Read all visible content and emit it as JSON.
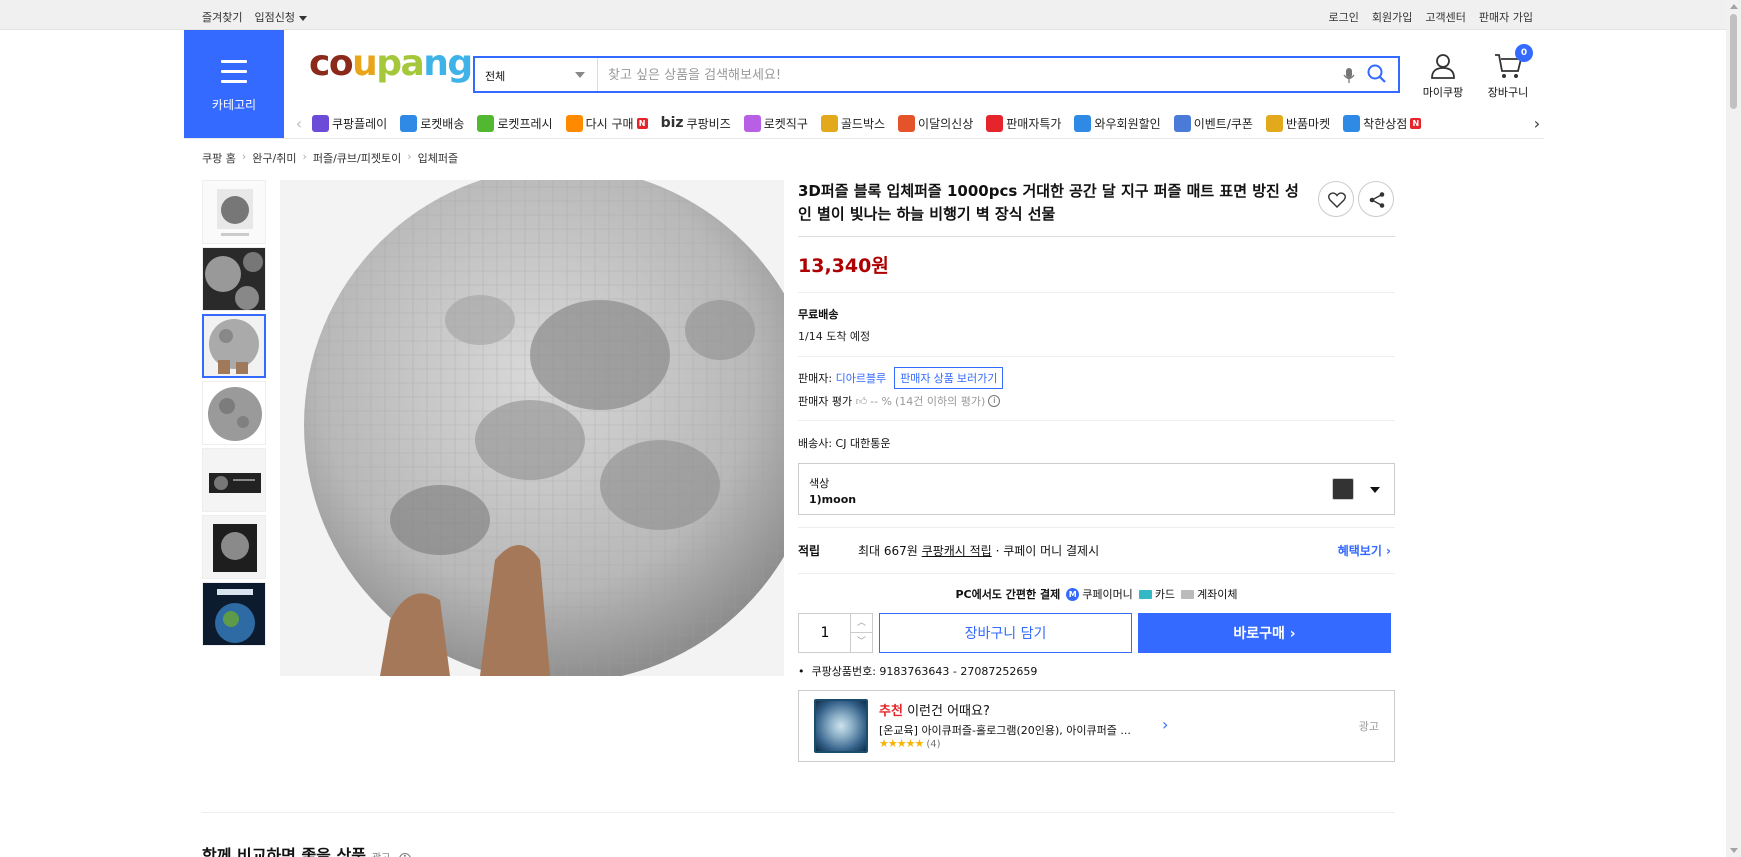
{
  "topbar": {
    "left": [
      "즐겨찾기",
      "입점신청"
    ],
    "right": [
      "로그인",
      "회원가입",
      "고객센터",
      "판매자 가입"
    ]
  },
  "header": {
    "category_label": "카테고리",
    "logo": {
      "p1": "co",
      "p2": "u",
      "p3": "pa",
      "p4": "ng"
    },
    "search_scope": "전체",
    "search_placeholder": "찾고 싶은 상품을 검색해보세요!",
    "mycoupang": "마이쿠팡",
    "cart": "장바구니",
    "cart_count": "0"
  },
  "nav": {
    "items": [
      {
        "label": "쿠팡플레이",
        "icon": "play-icon",
        "color": "#6b4bd8"
      },
      {
        "label": "로켓배송",
        "icon": "rocket-icon",
        "color": "#2f8ae5"
      },
      {
        "label": "로켓프레시",
        "icon": "rocket-fresh-icon",
        "color": "#52b832"
      },
      {
        "label": "다시 구매",
        "icon": "bag-icon",
        "color": "#ff8a00",
        "badge": "N"
      },
      {
        "label": "쿠팡비즈",
        "icon": "biz-icon",
        "prefix": "biz"
      },
      {
        "label": "로켓직구",
        "icon": "globe-icon",
        "color": "#b760e6"
      },
      {
        "label": "골드박스",
        "icon": "goldbox-icon",
        "color": "#e2a91c"
      },
      {
        "label": "이달의신상",
        "icon": "newbag-icon",
        "color": "#e5532b"
      },
      {
        "label": "판매자특가",
        "icon": "percent-icon",
        "color": "#e5242b"
      },
      {
        "label": "와우회원할인",
        "icon": "wow-icon",
        "color": "#2f8ae5"
      },
      {
        "label": "이벤트/쿠폰",
        "icon": "coupon-icon",
        "color": "#4b7bd8"
      },
      {
        "label": "반품마켓",
        "icon": "market-icon",
        "color": "#e2a91c"
      },
      {
        "label": "착한상점",
        "icon": "store-icon",
        "color": "#2f8ae5",
        "badge": "N"
      }
    ]
  },
  "breadcrumb": [
    "쿠팡 홈",
    "완구/취미",
    "퍼즐/큐브/피젯토이",
    "입체퍼즐"
  ],
  "product": {
    "title": "3D퍼즐 블록 입체퍼즐 1000pcs 거대한 공간 달 지구 퍼즐 매트 표면 방진 성인 별이 빛나는 하늘 비행기 벽 장식 선물",
    "price": "13,340원",
    "shipping_title": "무료배송",
    "arrival": "1/14 도착 예정",
    "seller_label": "판매자:",
    "seller_name": "디아르블루",
    "seller_button": "판매자 상품 보러가기",
    "rating_label": "판매자 평가",
    "rating_value": "-- %",
    "rating_note": "(14건 이하의 평가)",
    "carrier": "배송사:  CJ 대한통운",
    "option_label": "색상",
    "option_value": "1)moon",
    "reward_label": "적립",
    "reward_text1": "최대 667원",
    "reward_link": "쿠팡캐시 적립",
    "reward_text2": "· 쿠페이 머니 결제시",
    "reward_more": "혜택보기",
    "pay_title": "PC에서도 간편한 결제",
    "pay_methods": [
      "쿠페이머니",
      "카드",
      "계좌이체"
    ],
    "quantity": "1",
    "add_cart": "장바구니 담기",
    "buy_now": "바로구매",
    "product_no": "쿠팡상품번호: 9183763643 - 27087252659"
  },
  "recommend": {
    "title_red": "추천",
    "title_rest": "이런건 어때요?",
    "name": "[온교육] 아이큐퍼즐-홀로그램(20인용), 아이큐퍼즐 ...",
    "stars": "★★★★★",
    "count": "(4)",
    "ad": "광고"
  },
  "bottom": {
    "title": "함께 비교하면 좋을 상품",
    "ad": "광고"
  }
}
